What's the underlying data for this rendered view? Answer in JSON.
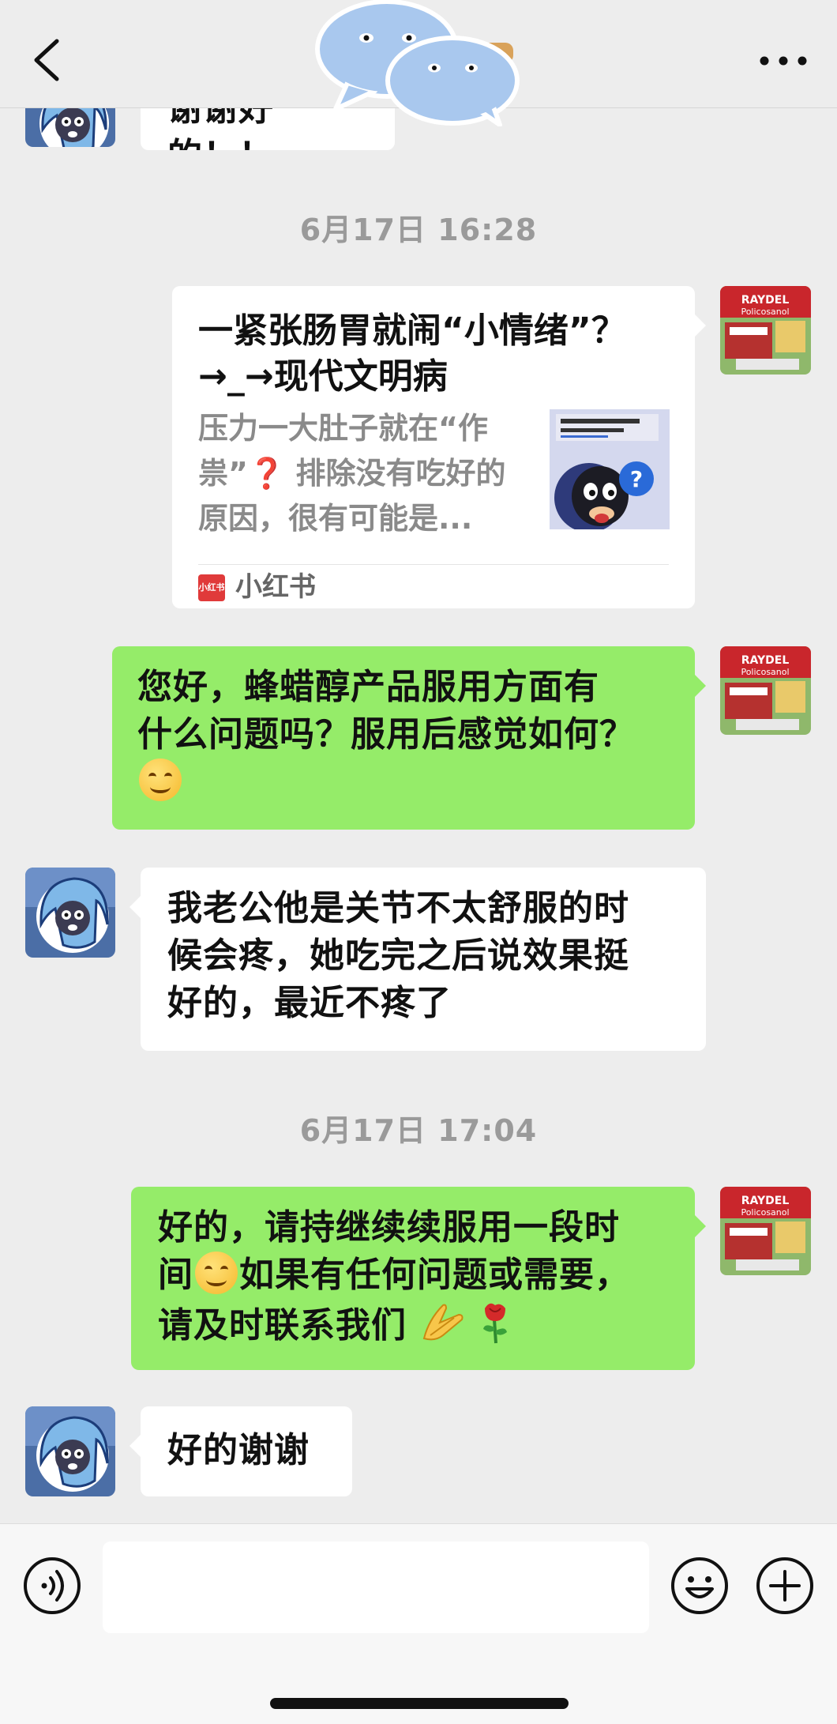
{
  "timestamps": [
    "6月17日 16:28",
    "6月17日 17:04"
  ],
  "partial_top_message": "谢谢好的！！",
  "link_card": {
    "title": "一紧张肠胃就闹“小情绪”？→_→现代文明病",
    "description": "压力一大肚子就在“作祟”❓ 排除没有吃好的原因，很有可能是...",
    "source": "小红书",
    "source_icon_text": "小红书"
  },
  "messages": {
    "m1": {
      "line1": "您好，蜂蜡醇产品服用方面有",
      "line2": "什么问题吗？服用后感觉如何？"
    },
    "m2": {
      "line1": "我老公他是关节不太舒服的时",
      "line2": "候会疼，她吃完之后说效果挺",
      "line3": "好的，最近不疼了"
    },
    "m3": {
      "line1": "好的，请持继续续服用一段时",
      "line2a": "间",
      "line2b": "如果有任何问题或需要，",
      "line3": "请及时联系我们"
    },
    "m4": {
      "text": "好的谢谢"
    }
  },
  "product_avatar": {
    "brand": "RAYDEL",
    "product": "Policosanol"
  },
  "input": {
    "placeholder": ""
  },
  "colors": {
    "background": "#ededed",
    "sent_bubble": "#95ec69",
    "received_bubble": "#ffffff",
    "timestamp": "#9a9a9a"
  }
}
